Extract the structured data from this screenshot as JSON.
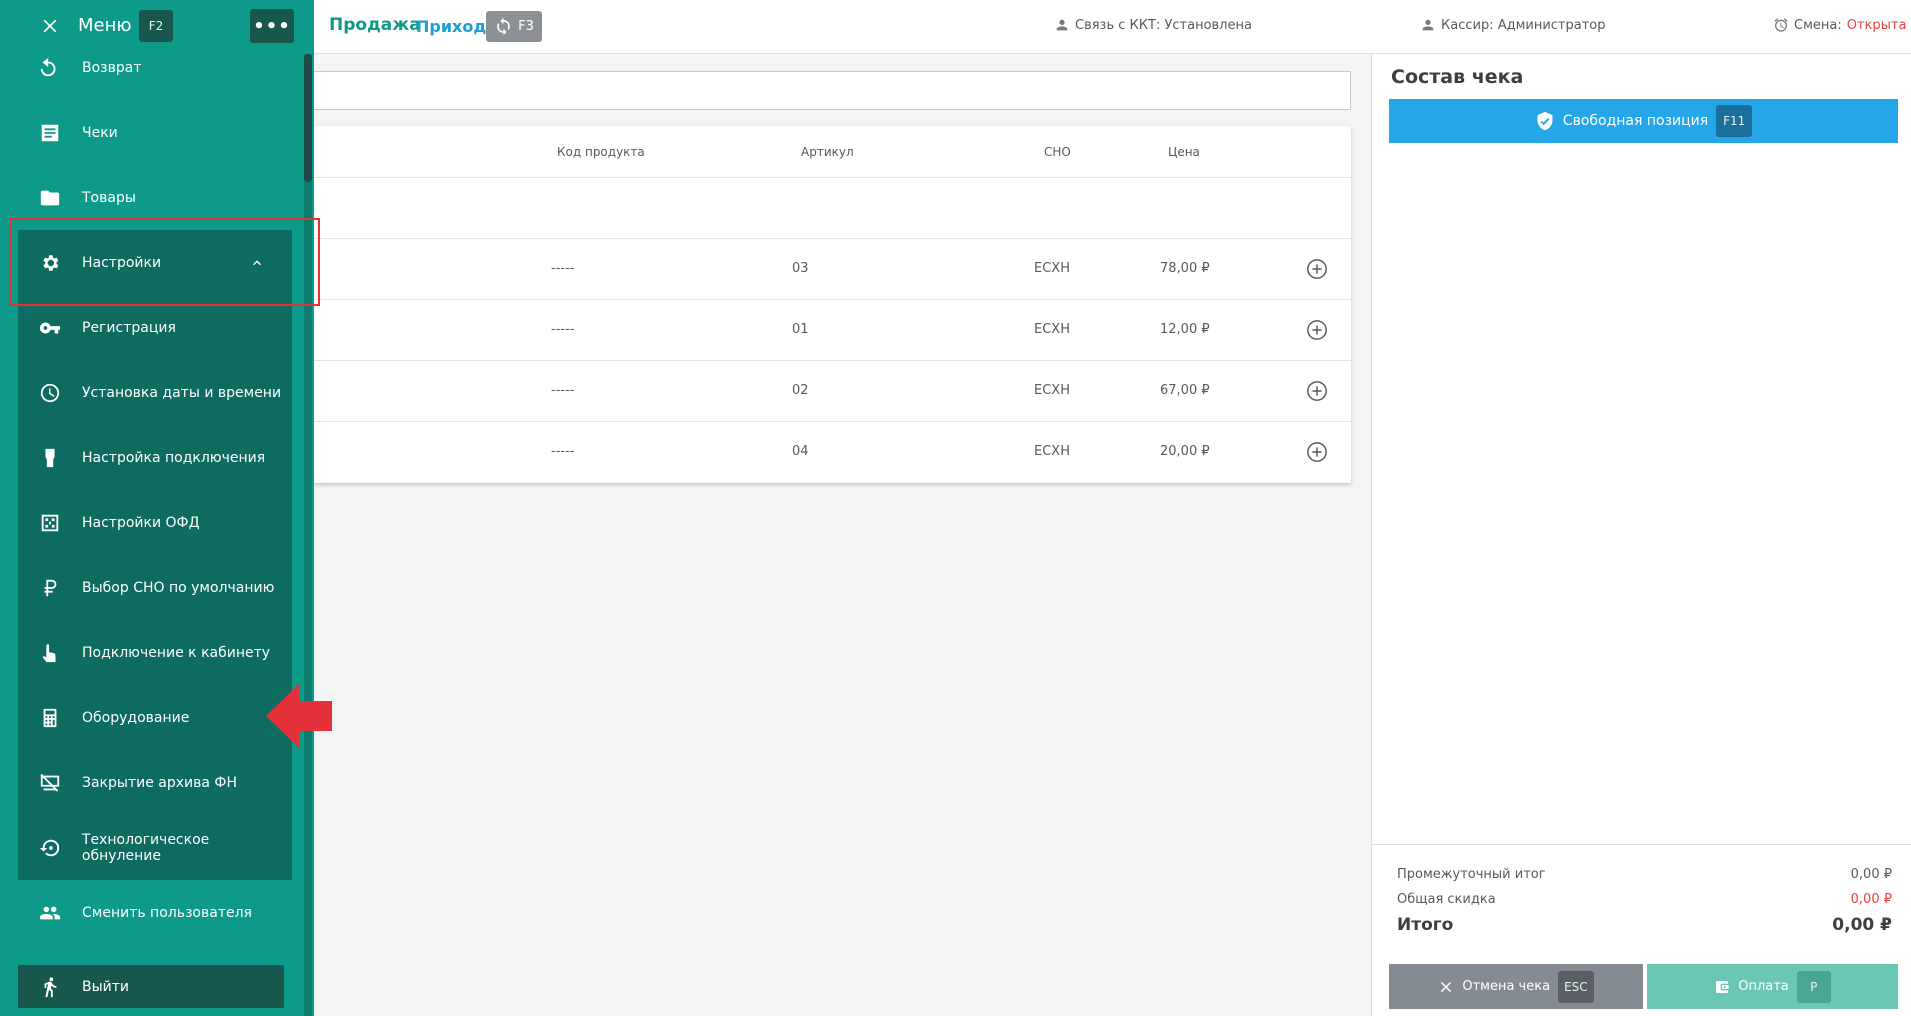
{
  "header": {
    "tab_sale": "Продажа",
    "tab_income": "Приход",
    "sync_key": "F3",
    "kkt_status": "Связь с ККТ: Установлена",
    "cashier": "Кассир: Администратор",
    "shift_label": "Смена:",
    "shift_value": "Открыта"
  },
  "sidebar": {
    "title": "Меню",
    "menu_key": "F2",
    "more_label": "•••",
    "items": [
      {
        "label": "Возврат",
        "icon": "return-icon"
      },
      {
        "label": "Чеки",
        "icon": "receipts-icon"
      },
      {
        "label": "Товары",
        "icon": "folder-icon"
      },
      {
        "label": "Настройки",
        "icon": "gear-icon"
      }
    ],
    "settings_sub": [
      {
        "label": "Регистрация",
        "icon": "key-icon"
      },
      {
        "label": "Установка даты и времени",
        "icon": "clock-icon"
      },
      {
        "label": "Настройка подключения",
        "icon": "plug-icon"
      },
      {
        "label": "Настройки ОФД",
        "icon": "ofd-icon"
      },
      {
        "label": "Выбор СНО по умолчанию",
        "icon": "ruble-icon"
      },
      {
        "label": "Подключение к кабинету",
        "icon": "touch-icon"
      },
      {
        "label": "Оборудование",
        "icon": "calculator-icon"
      },
      {
        "label": "Закрытие архива ФН",
        "icon": "archive-close-icon"
      },
      {
        "label": "Технологическое обнуление",
        "icon": "reset-icon"
      }
    ],
    "switch_user": "Сменить пользователя",
    "logout": "Выйти"
  },
  "products": {
    "search_placeholder": "",
    "columns": [
      "Код продукта",
      "Артикул",
      "СНО",
      "Цена"
    ],
    "rows": [
      {
        "code": "-----",
        "article": "03",
        "sno": "ЕСХН",
        "price": "78,00 ₽"
      },
      {
        "code": "-----",
        "article": "01",
        "sno": "ЕСХН",
        "price": "12,00 ₽"
      },
      {
        "code": "-----",
        "article": "02",
        "sno": "ЕСХН",
        "price": "67,00 ₽"
      },
      {
        "code": "-----",
        "article": "04",
        "sno": "ЕСХН",
        "price": "20,00 ₽"
      }
    ]
  },
  "receipt": {
    "title": "Состав чека",
    "free_position": "Свободная позиция",
    "free_position_key": "F11",
    "subtotal_label": "Промежуточный итог",
    "subtotal_value": "0,00 ₽",
    "discount_label": "Общая скидка",
    "discount_value": "0,00 ₽",
    "total_label": "Итого",
    "total_value": "0,00 ₽",
    "cancel_label": "Отмена чека",
    "cancel_key": "ESC",
    "pay_label": "Оплата",
    "pay_key": "P"
  },
  "colors": {
    "sidebar": "#0e9a88",
    "submenu": "#0d6b5f",
    "accent_blue": "#25a6e8",
    "alert_red": "#e94040"
  }
}
